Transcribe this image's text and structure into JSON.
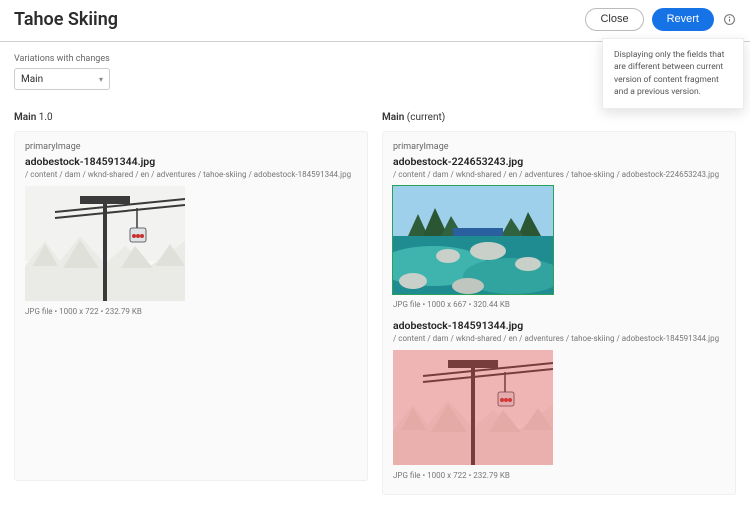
{
  "header": {
    "title": "Tahoe Skiing",
    "close": "Close",
    "revert": "Revert",
    "tooltip": "Displaying only the fields that are different between current version of content fragment and a previous version."
  },
  "controls": {
    "label": "Variations with changes",
    "selected": "Main"
  },
  "left": {
    "heading_bold": "Main",
    "heading_rest": " 1.0",
    "field": "primaryImage",
    "asset1": {
      "name": "adobestock-184591344.jpg",
      "path": "/ content / dam / wknd-shared / en / adventures / tahoe-skiing / adobestock-184591344.jpg",
      "meta": "JPG file • 1000 x 722 • 232.79 KB"
    }
  },
  "right": {
    "heading_bold": "Main",
    "heading_rest": " (current)",
    "field": "primaryImage",
    "asset1": {
      "name": "adobestock-224653243.jpg",
      "path": "/ content / dam / wknd-shared / en / adventures / tahoe-skiing / adobestock-224653243.jpg",
      "meta": "JPG file • 1000 x 667 • 320.44 KB"
    },
    "asset2": {
      "name": "adobestock-184591344.jpg",
      "path": "/ content / dam / wknd-shared / en / adventures / tahoe-skiing / adobestock-184591344.jpg",
      "meta": "JPG file • 1000 x 722 • 232.79 KB"
    }
  }
}
